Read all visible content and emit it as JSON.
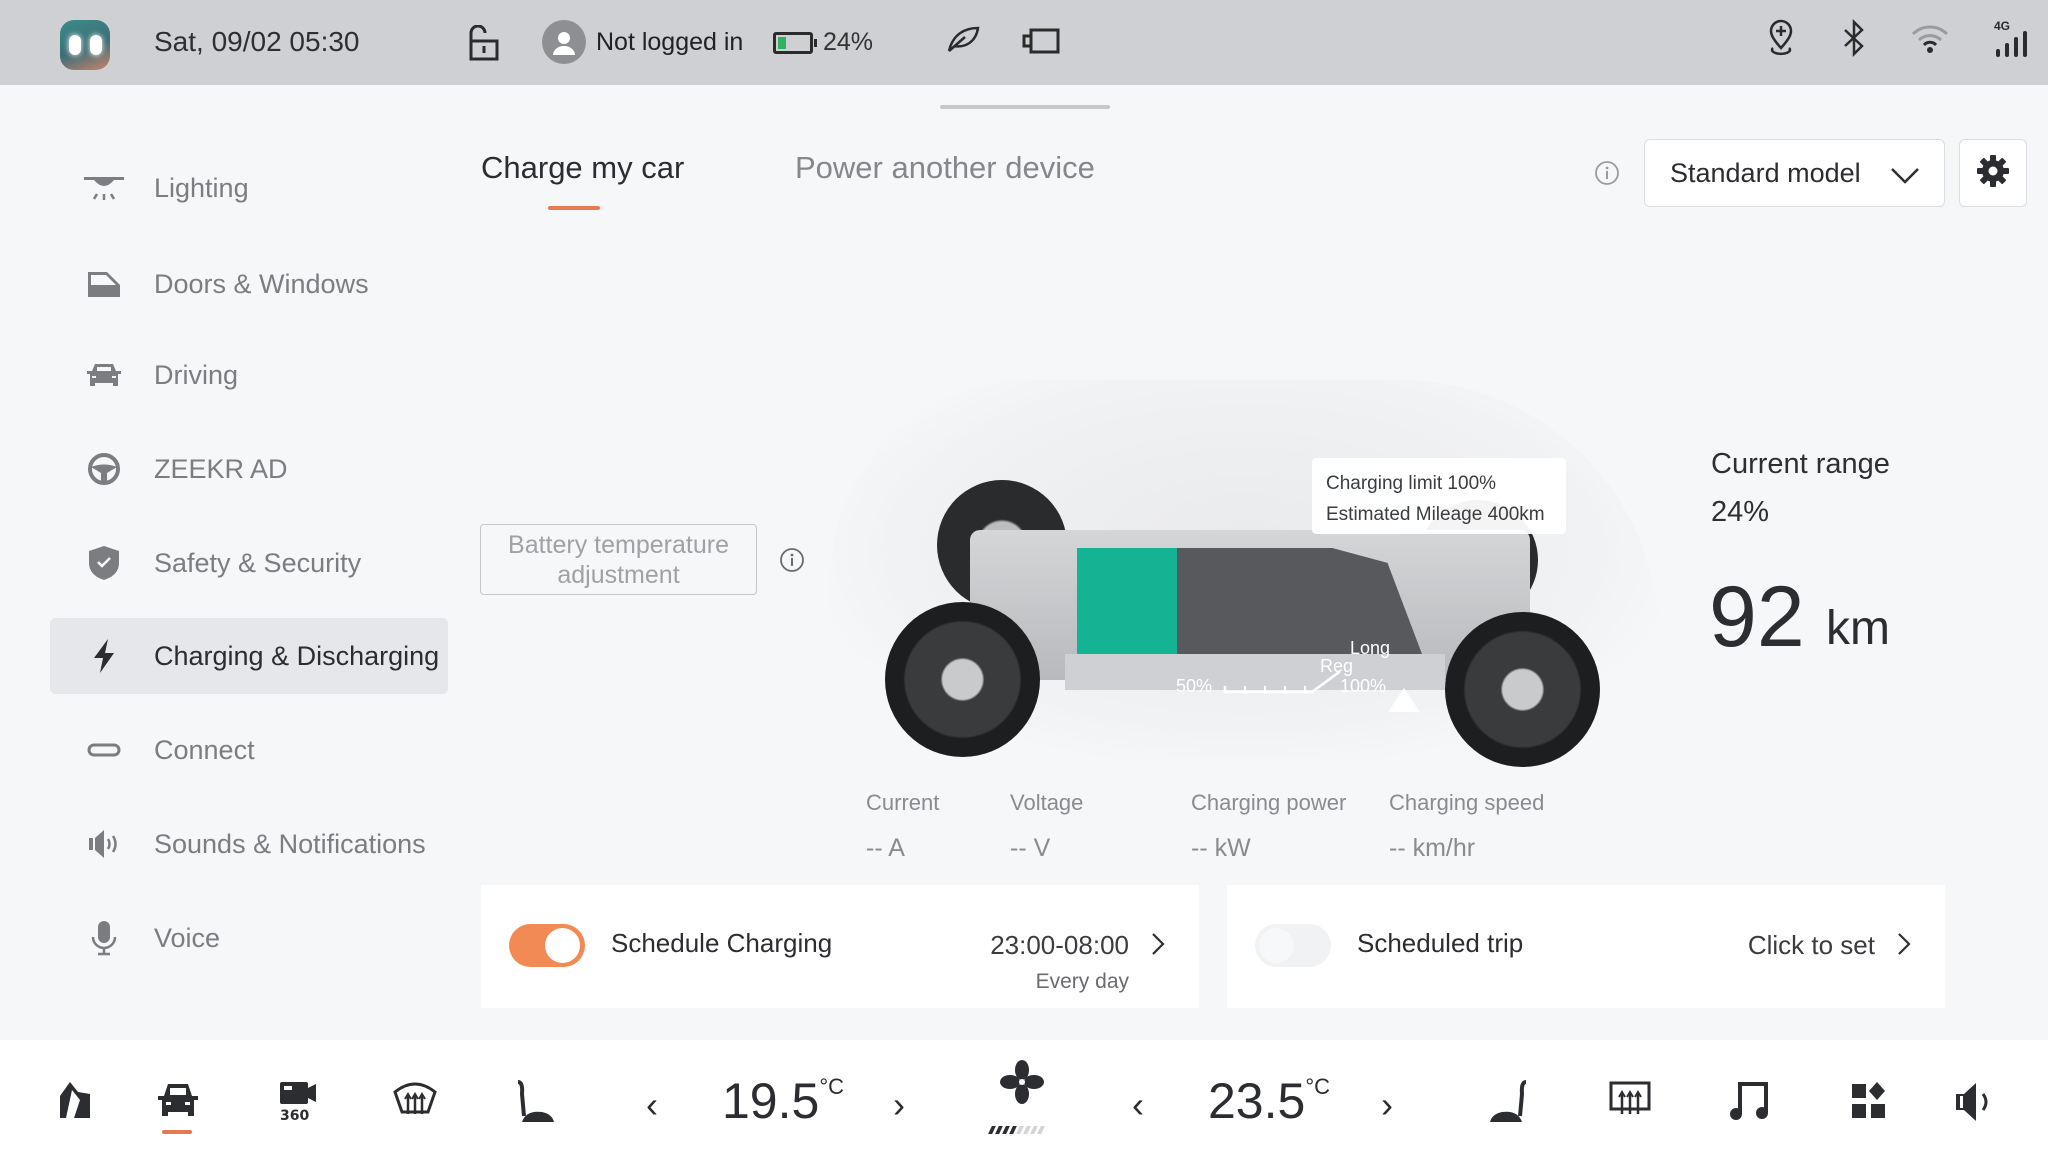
{
  "status_bar": {
    "datetime": "Sat, 09/02 05:30",
    "user_status": "Not logged in",
    "battery_percent_text": "24%",
    "battery_level": 0.24,
    "battery_color": "#2fb35e",
    "network_label": "4G",
    "right_icons": [
      "location-plus-icon",
      "bluetooth-icon",
      "wifi-icon",
      "signal-4g-icon"
    ]
  },
  "sidebar": {
    "items": [
      {
        "label": "Lighting",
        "icon": "lighting-icon",
        "active": false
      },
      {
        "label": "Doors & Windows",
        "icon": "door-icon",
        "active": false
      },
      {
        "label": "Driving",
        "icon": "car-icon",
        "active": false
      },
      {
        "label": "ZEEKR AD",
        "icon": "steering-wheel-icon",
        "active": false
      },
      {
        "label": "Safety & Security",
        "icon": "shield-icon",
        "active": false
      },
      {
        "label": "Charging & Discharging",
        "icon": "lightning-icon",
        "active": true
      },
      {
        "label": "Connect",
        "icon": "link-icon",
        "active": false
      },
      {
        "label": "Sounds & Notifications",
        "icon": "speaker-icon",
        "active": false
      },
      {
        "label": "Voice",
        "icon": "microphone-icon",
        "active": false
      }
    ]
  },
  "tabs": [
    {
      "label": "Charge my car",
      "active": true
    },
    {
      "label": "Power another device",
      "active": false
    }
  ],
  "model_select": {
    "value": "Standard model"
  },
  "battery_temp_button": {
    "line1": "Battery temperature",
    "line2": "adjustment"
  },
  "charging_visual": {
    "tooltip_line1": "Charging limit 100%",
    "tooltip_line2": "Estimated Mileage 400km",
    "scale_min_label": "50%",
    "scale_max_label": "100%",
    "reg_label": "Reg",
    "long_label": "Long",
    "charge_level": 0.24,
    "charge_color": "#14b394"
  },
  "range": {
    "label": "Current range",
    "percent": "24%",
    "value": "92",
    "unit": "km"
  },
  "metrics": [
    {
      "label": "Current",
      "value": "-- A"
    },
    {
      "label": "Voltage",
      "value": "-- V"
    },
    {
      "label": "Charging power",
      "value": "-- kW"
    },
    {
      "label": "Charging speed",
      "value": "-- km/hr"
    }
  ],
  "cards": {
    "schedule_charging": {
      "title": "Schedule Charging",
      "value": "23:00-08:00",
      "sub": "Every day",
      "enabled": true
    },
    "scheduled_trip": {
      "title": "Scheduled trip",
      "value": "Click to set",
      "enabled": false
    }
  },
  "dock": {
    "left_temp": "19.5",
    "right_temp": "23.5",
    "temp_unit": "°C",
    "fan_level": 4,
    "fan_max": 8,
    "accent": "#e57a52"
  }
}
